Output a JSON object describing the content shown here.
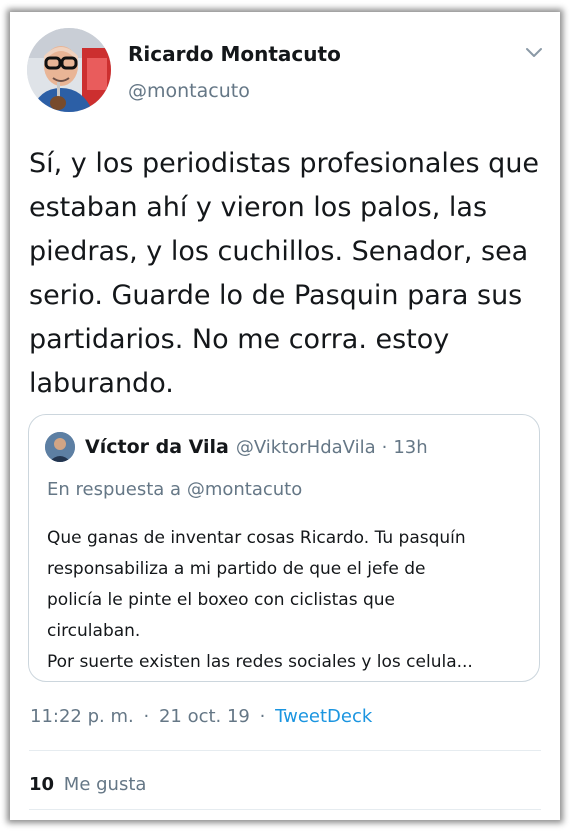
{
  "tweet": {
    "author_name": "Ricardo Montacuto",
    "author_handle": "@montacuto",
    "text": "Sí, y los periodistas profesionales que estaban ahí y vieron los palos, las piedras, y los cuchillos. Senador, sea serio. Guarde lo de Pasquin para sus partidarios. No me corra. estoy laburando.",
    "time": "11:22 p. m.",
    "date": "21 oct. 19",
    "source": "TweetDeck",
    "likes_count": "10",
    "likes_label": "Me gusta",
    "separator": "·"
  },
  "quoted": {
    "author_name": "Víctor da Vila",
    "author_handle": "@ViktorHdaVila",
    "time": "13h",
    "reply_prefix": "En respuesta a",
    "reply_handle": "@montacuto",
    "lines": [
      "Que ganas de inventar cosas Ricardo. Tu pasquín",
      "responsabiliza a mi partido de que el jefe de",
      "policía le pinte el boxeo con ciclistas que",
      "circulaban.",
      "Por suerte existen las redes sociales y los celula..."
    ]
  },
  "icons": {
    "menu": "chevron-down-icon",
    "avatar": "author-avatar",
    "quoted_avatar": "quoted-author-avatar"
  },
  "colors": {
    "text": "#14171a",
    "muted": "#657786",
    "accent": "#1b95e0",
    "border": "#ccd6dd"
  }
}
